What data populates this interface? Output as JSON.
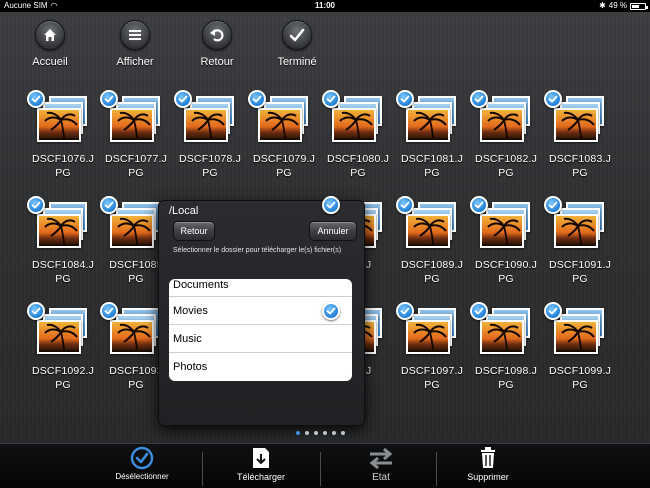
{
  "statusbar": {
    "carrier": "Aucune SIM",
    "time": "11:00",
    "battery": "49 %",
    "battery_level": 0.49
  },
  "toolbar": {
    "home_label": "Accueil",
    "view_label": "Afficher",
    "back_label": "Retour",
    "done_label": "Terminé"
  },
  "photos": [
    [
      "DSCF1076.J",
      "PG"
    ],
    [
      "DSCF1077.J",
      "PG"
    ],
    [
      "DSCF1078.J",
      "PG"
    ],
    [
      "DSCF1079.J",
      "PG"
    ],
    [
      "DSCF1080.J",
      "PG"
    ],
    [
      "DSCF1081.J",
      "PG"
    ],
    [
      "DSCF1082.J",
      "PG"
    ],
    [
      "DSCF1083.J",
      "PG"
    ],
    [
      "DSCF1084.J",
      "PG"
    ],
    [
      "DSCF1085",
      "PG"
    ],
    [
      "",
      ""
    ],
    [
      "",
      ""
    ],
    [
      "088.J",
      "PG"
    ],
    [
      "DSCF1089.J",
      "PG"
    ],
    [
      "DSCF1090.J",
      "PG"
    ],
    [
      "DSCF1091.J",
      "PG"
    ],
    [
      "DSCF1092.J",
      "PG"
    ],
    [
      "DSCF1093",
      "PG"
    ],
    [
      "",
      ""
    ],
    [
      "",
      ""
    ],
    [
      "096.J",
      "PG"
    ],
    [
      "DSCF1097.J",
      "PG"
    ],
    [
      "DSCF1098.J",
      "PG"
    ],
    [
      "DSCF1099.J",
      "PG"
    ]
  ],
  "popup": {
    "path": "/Local",
    "back_label": "Retour",
    "cancel_label": "Annuler",
    "hint": "Sélectionner le dossier pour télécharger le(s) fichier(s)",
    "folders": [
      "Documents",
      "Movies",
      "Music",
      "Photos"
    ]
  },
  "pager": {
    "pages": 6,
    "current": 1
  },
  "bottombar": {
    "deselect_label": "Désélectionner",
    "download_label": "Télécharger",
    "status_label": "Etat",
    "delete_label": "Supprimer"
  },
  "colors": {
    "accent_blue": "#3f8ee0",
    "background": "#2e3032",
    "popup_bg": "#232527"
  }
}
